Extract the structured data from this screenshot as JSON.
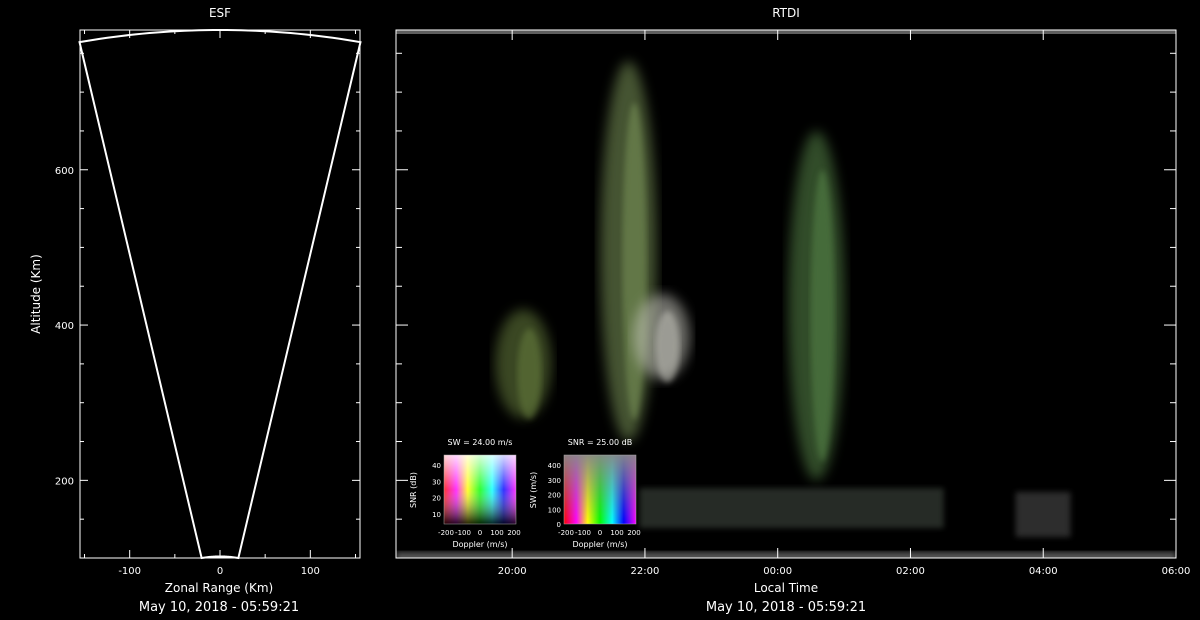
{
  "chart_data": [
    {
      "type": "scatter",
      "title": "ESF",
      "xlabel": "Zonal Range (Km)",
      "ylabel": "Altitude (Km)",
      "xlim": [
        -155,
        155
      ],
      "ylim": [
        100,
        780
      ],
      "xticks": [
        -100,
        0,
        100
      ],
      "yticks": [
        200,
        400,
        600
      ],
      "xtick_labels": [
        "-100",
        "0",
        "100"
      ],
      "ytick_labels": [
        "200",
        "400",
        "600"
      ],
      "beam_outline": {
        "half_angle_deg": 11.5,
        "max_range_km": 780,
        "min_range_km": 102
      },
      "timestamp": "May 10, 2018 - 05:59:21"
    },
    {
      "type": "heatmap",
      "title": "RTDI",
      "xlabel": "Local Time",
      "xlim": [
        "18:15",
        "06:00"
      ],
      "ylim": [
        100,
        780
      ],
      "xticks": [
        "20:00",
        "22:00",
        "00:00",
        "02:00",
        "04:00",
        "06:00"
      ],
      "yticks": [
        200,
        400,
        600
      ],
      "timestamp": "May 10, 2018 - 05:59:21",
      "plumes": [
        {
          "t": "21:45",
          "alt_low": 250,
          "alt_high": 740,
          "color": "#7f9a5c"
        },
        {
          "t": "22:15",
          "alt_low": 330,
          "alt_high": 440,
          "color": "#c9c9c0"
        },
        {
          "t": "00:35",
          "alt_low": 200,
          "alt_high": 650,
          "color": "#5a8a4c"
        },
        {
          "t": "20:10",
          "alt_low": 280,
          "alt_high": 420,
          "color": "#6b8240"
        }
      ],
      "legends": [
        {
          "title": "SW = 24.00 m/s",
          "ylabel": "SNR (dB)",
          "xlabel": "Doppler (m/s)",
          "yticks": [
            "40",
            "30",
            "20",
            "10"
          ],
          "xticks": [
            "-200",
            "-100",
            "0",
            "100",
            "200"
          ]
        },
        {
          "title": "SNR = 25.00 dB",
          "ylabel": "SW (m/s)",
          "xlabel": "Doppler (m/s)",
          "yticks": [
            "400",
            "300",
            "200",
            "100",
            "0"
          ],
          "xticks": [
            "-200",
            "-100",
            "0",
            "100",
            "200"
          ]
        }
      ]
    }
  ]
}
